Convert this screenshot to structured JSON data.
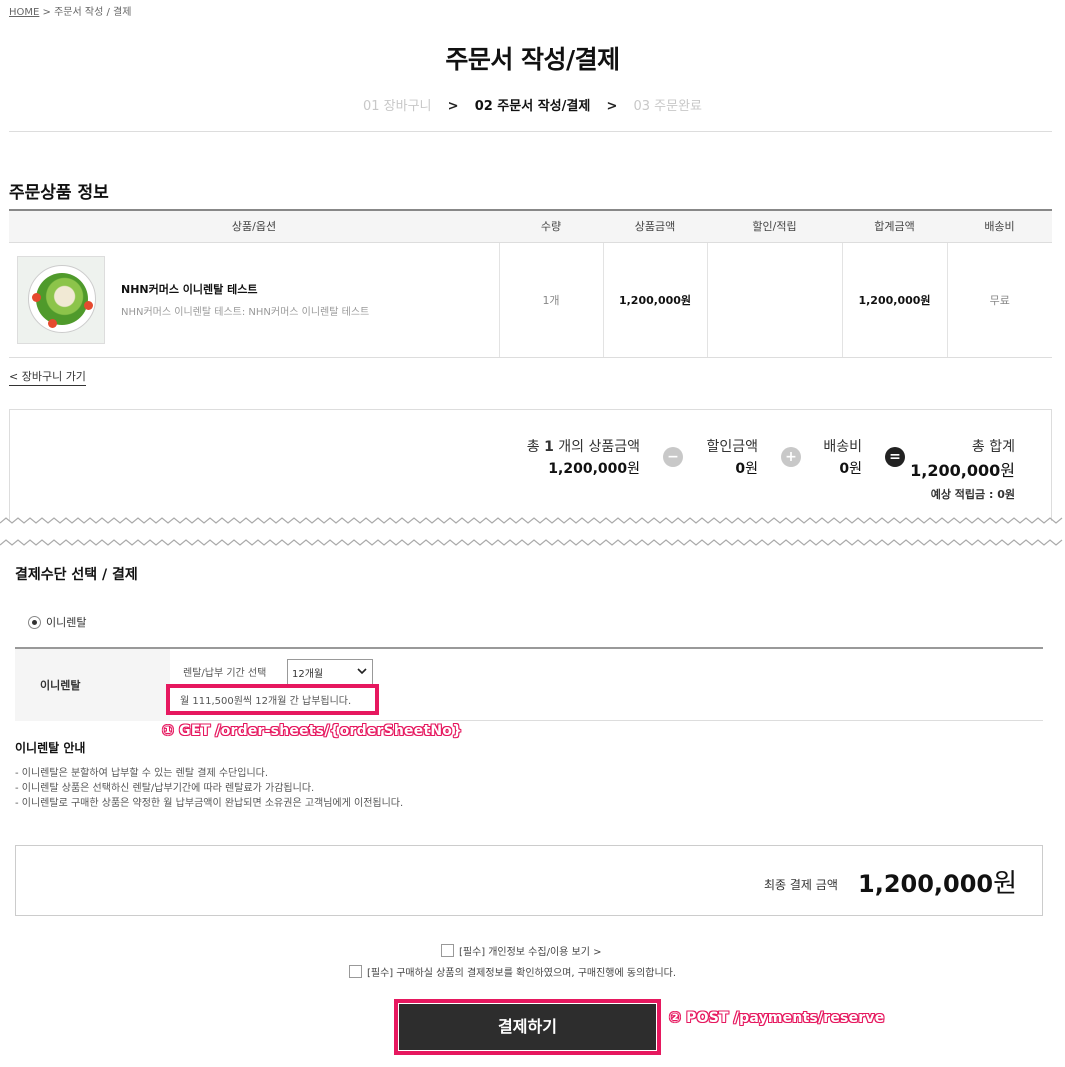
{
  "breadcrumb": {
    "home": "HOME",
    "separator": ">",
    "current": "주문서 작성 / 결제"
  },
  "page_title": "주문서 작성/결제",
  "steps": [
    {
      "label": "01 장바구니",
      "state": "done"
    },
    {
      "label": "02 주문서 작성/결제",
      "state": "current"
    },
    {
      "label": "03 주문완료",
      "state": "todo"
    }
  ],
  "step_arrow": ">",
  "order_items": {
    "title": "주문상품 정보",
    "headers": [
      "상품/옵션",
      "수량",
      "상품금액",
      "할인/적립",
      "합계금액",
      "배송비"
    ],
    "rows": [
      {
        "name": "NHN커머스 이니렌탈 테스트",
        "option": "NHN커머스 이니렌탈 테스트: NHN커머스 이니렌탈 테스트",
        "qty": "1개",
        "price": "1,200,000원",
        "discount": "",
        "total": "1,200,000원",
        "shipping": "무료"
      }
    ]
  },
  "cart_link": "< 장바구니 가기",
  "summary": {
    "count_prefix": "총",
    "count": "1",
    "count_suffix": "개의 상품금액",
    "goods_amount": "1,200,000",
    "discount_label": "할인금액",
    "discount_amount": "0",
    "shipping_label": "배송비",
    "shipping_amount": "0",
    "total_label": "총 합계",
    "total_amount": "1,200,000",
    "won": "원",
    "points": "예상 적립금 : 0원",
    "op_minus": "−",
    "op_plus": "+",
    "op_equal": "="
  },
  "payment": {
    "title": "결제수단 선택 / 결제",
    "method_label": "이니렌탈",
    "row_label": "이니렌탈",
    "period_label": "렌탈/납부 기간 선택",
    "period_value": "12개월",
    "period_desc": "월 111,500원씩 12개월 간 납부됩니다.",
    "api_1": "① GET /order-sheets/{orderSheetNo}",
    "notice_title": "이니렌탈 안내",
    "notice_lines": [
      "- 이니렌탈은 분할하여 납부할 수 있는 렌탈 결제 수단입니다.",
      "- 이니렌탈 상품은 선택하신 렌탈/납부기간에 따라 렌탈료가 가감됩니다.",
      "- 이니렌탈로 구매한 상품은 약정한 월 납부금액이 완납되면 소유권은 고객님에게 이전됩니다."
    ]
  },
  "final": {
    "label": "최종 결제 금액",
    "amount": "1,200,000",
    "won": "원"
  },
  "agreements": [
    {
      "prefix": "[필수]",
      "text": "개인정보 수집/이용 보기 >"
    },
    {
      "prefix": "[필수]",
      "text": "구매하실 상품의 결제정보를 확인하였으며, 구매진행에 동의합니다."
    }
  ],
  "pay_button": "결제하기",
  "api_2": "② POST /payments/reserve",
  "colors": {
    "highlight": "#e6185f",
    "button": "#2d2d2d"
  }
}
